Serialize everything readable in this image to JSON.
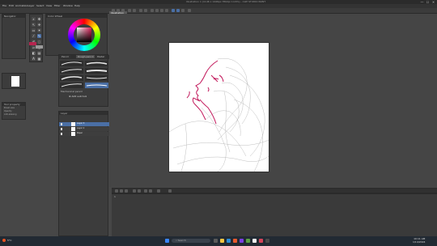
{
  "window": {
    "title": "Illustration 1 (1146 x 1446px 350dpi 14.6%) - CLIP STUDIO PAINT",
    "controls": [
      "—",
      "☐",
      "✕"
    ]
  },
  "menu": [
    "File",
    "Edit",
    "Animation",
    "Layer",
    "Select",
    "View",
    "Filter",
    "Window",
    "Help"
  ],
  "canvas_tab": {
    "label": "Illustration"
  },
  "navigator": {
    "title": "Navigator"
  },
  "color_panel": {
    "title": "Color Wheel"
  },
  "colors": {
    "main": "#b5254f",
    "sub": "#9a9a9a",
    "drawing": "#c2185b",
    "accent": "#4a6fa5"
  },
  "brush_panel": {
    "tabs": [
      "Pencil",
      "Rough pencil",
      "Pastel"
    ],
    "brushes": [
      {
        "name": "Mechanical pencil",
        "right_name": "Real pencil"
      },
      {
        "name": "Light pencil",
        "right_name": "Thick pencil"
      },
      {
        "name": "Rough pencil",
        "right_name": "Thick pencil 2"
      },
      {
        "name": "Pencil to deform",
        "right_name": "Pencil 2"
      }
    ],
    "add_label": "Add sub tool"
  },
  "layer_panel": {
    "title": "Layer",
    "layers": [
      {
        "name": "Layer 3",
        "opacity": "100 % Normal"
      },
      {
        "name": "Layer 2",
        "opacity": "100 % Normal"
      },
      {
        "name": "Paper",
        "opacity": ""
      }
    ]
  },
  "tool_property": {
    "title": "Tool property",
    "rows": [
      "Brush size",
      "Opacity",
      "Anti-aliasing",
      "Brush density"
    ]
  },
  "timeline": {
    "frame_label": "1"
  },
  "taskbar": {
    "weather": "5°C",
    "search_placeholder": "Search",
    "time": "10:11 AM",
    "date": "1/14/2024"
  }
}
